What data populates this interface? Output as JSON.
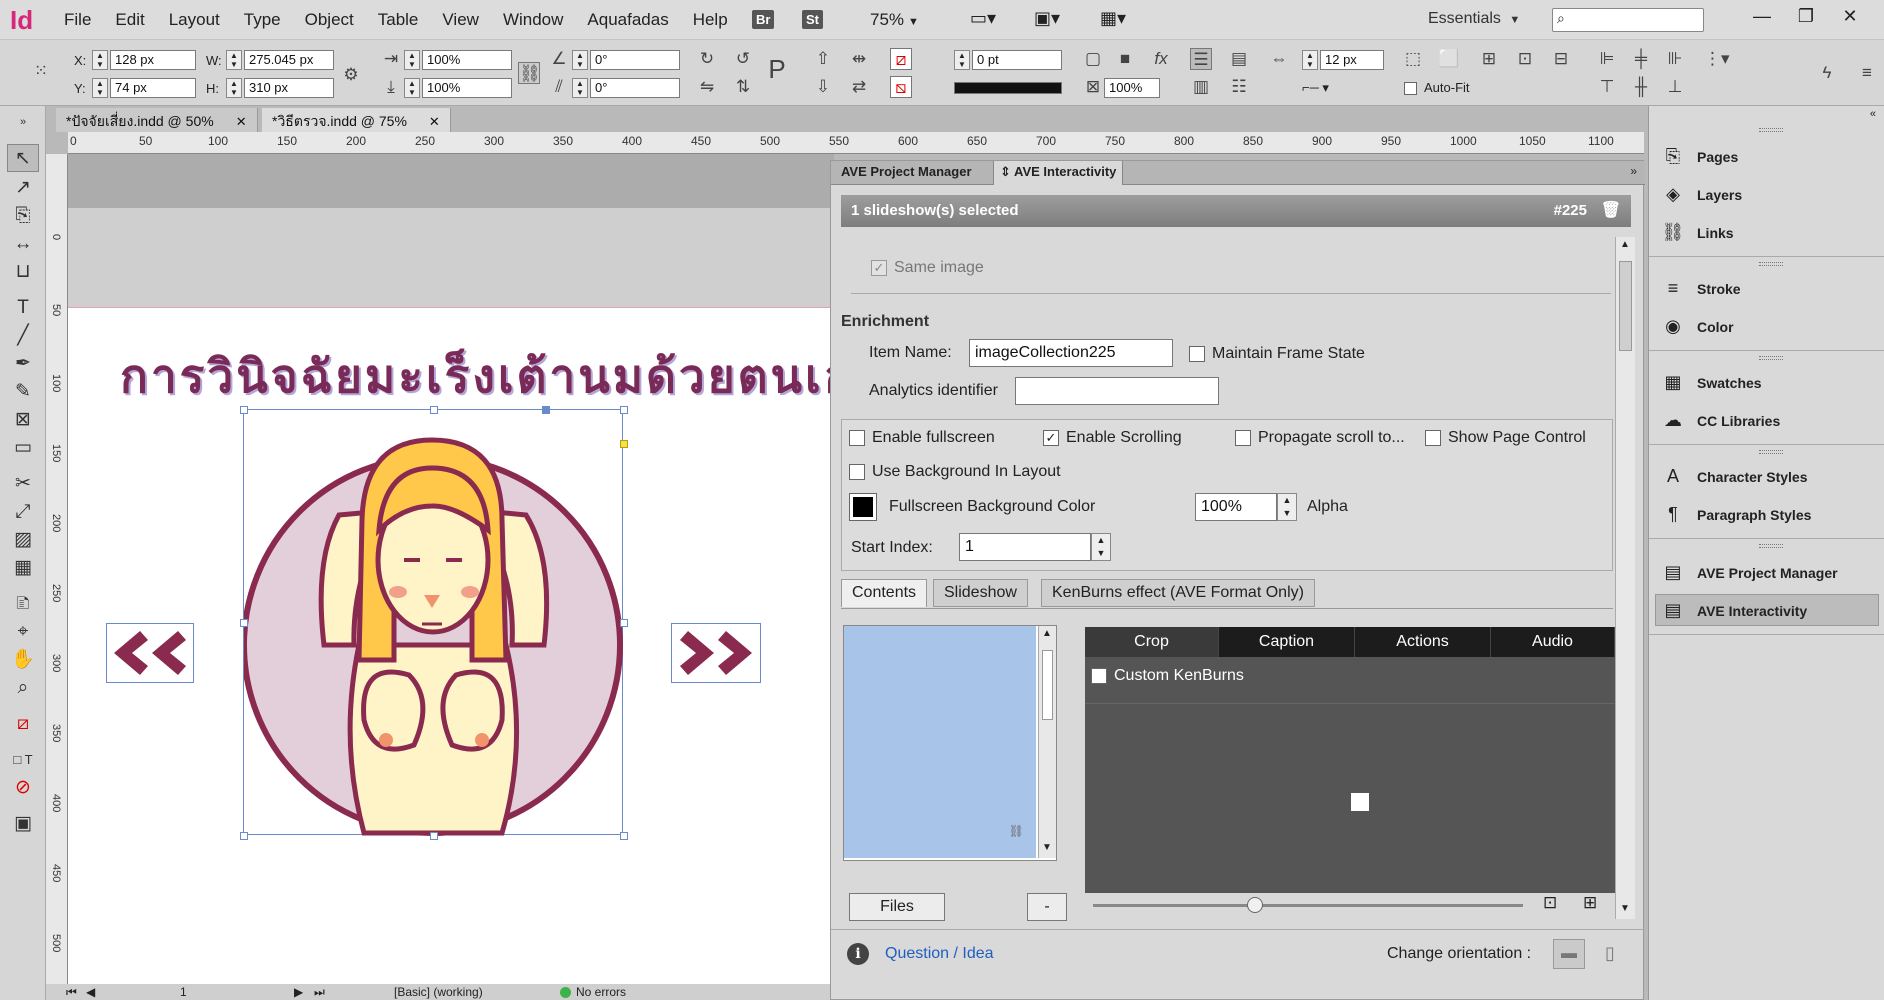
{
  "app": {
    "icon": "Id"
  },
  "menubar": {
    "items": [
      "File",
      "Edit",
      "Layout",
      "Type",
      "Object",
      "Table",
      "View",
      "Window",
      "Aquafadas",
      "Help"
    ],
    "bridge": "Br",
    "stock": "St",
    "zoom": "75%",
    "workspace": "Essentials"
  },
  "control": {
    "x": "128 px",
    "y": "74 px",
    "w": "275.045 px",
    "h": "310 px",
    "scale_x": "100%",
    "scale_y": "100%",
    "rotate": "0°",
    "shear": "0°",
    "stroke_weight": "0 pt",
    "opacity": "100%",
    "gap": "12 px",
    "autofit": "Auto-Fit"
  },
  "tabs": [
    {
      "label": "*ปัจจัยเสี่ยง.indd @ 50%"
    },
    {
      "label": "*วิธีตรวจ.indd @ 75%"
    }
  ],
  "ruler": [
    "0",
    "50",
    "100",
    "150",
    "200",
    "250",
    "300",
    "350",
    "400",
    "450",
    "500",
    "550",
    "600",
    "650",
    "700",
    "750",
    "800",
    "850",
    "900",
    "950",
    "1000",
    "1050",
    "1100"
  ],
  "canvas": {
    "heading": "การวินิจฉัยมะเร็งเต้านมด้วยตนเอง"
  },
  "ave": {
    "tab_manager": "AVE Project Manager",
    "tab_interactivity": "AVE Interactivity",
    "selection": "1 slideshow(s) selected",
    "id": "#225",
    "same_image": "Same image",
    "enrichment": "Enrichment",
    "item_name_label": "Item Name:",
    "item_name": "imageCollection225",
    "maintain_frame": "Maintain Frame State",
    "analytics_label": "Analytics identifier",
    "analytics_value": "",
    "enable_fullscreen": "Enable fullscreen",
    "enable_scrolling": "Enable Scrolling",
    "propagate": "Propagate scroll to...",
    "show_page_control": "Show Page Control",
    "use_bg": "Use Background In Layout",
    "fs_bg_color": "Fullscreen Background Color",
    "alpha_value": "100%",
    "alpha_label": "Alpha",
    "start_index_label": "Start Index:",
    "start_index": "1",
    "subtabs": [
      "Contents",
      "Slideshow",
      "KenBurns effect (AVE Format Only)"
    ],
    "darktabs": [
      "Crop",
      "Caption",
      "Actions",
      "Audio"
    ],
    "custom_kenburns": "Custom KenBurns",
    "files_btn": "Files",
    "minus_btn": "-",
    "question": "Question / Idea",
    "change_orientation": "Change orientation :"
  },
  "rightpanel": {
    "items": [
      "Pages",
      "Layers",
      "Links",
      "Stroke",
      "Color",
      "Swatches",
      "CC Libraries",
      "Character Styles",
      "Paragraph Styles",
      "AVE Project Manager",
      "AVE Interactivity"
    ]
  },
  "status": {
    "page": "1",
    "style": "[Basic] (working)",
    "errors": "No errors"
  },
  "colors": {
    "accent": "#d6277a",
    "heading": "#7a2a56",
    "slide_bg": "#a8c4e8"
  }
}
